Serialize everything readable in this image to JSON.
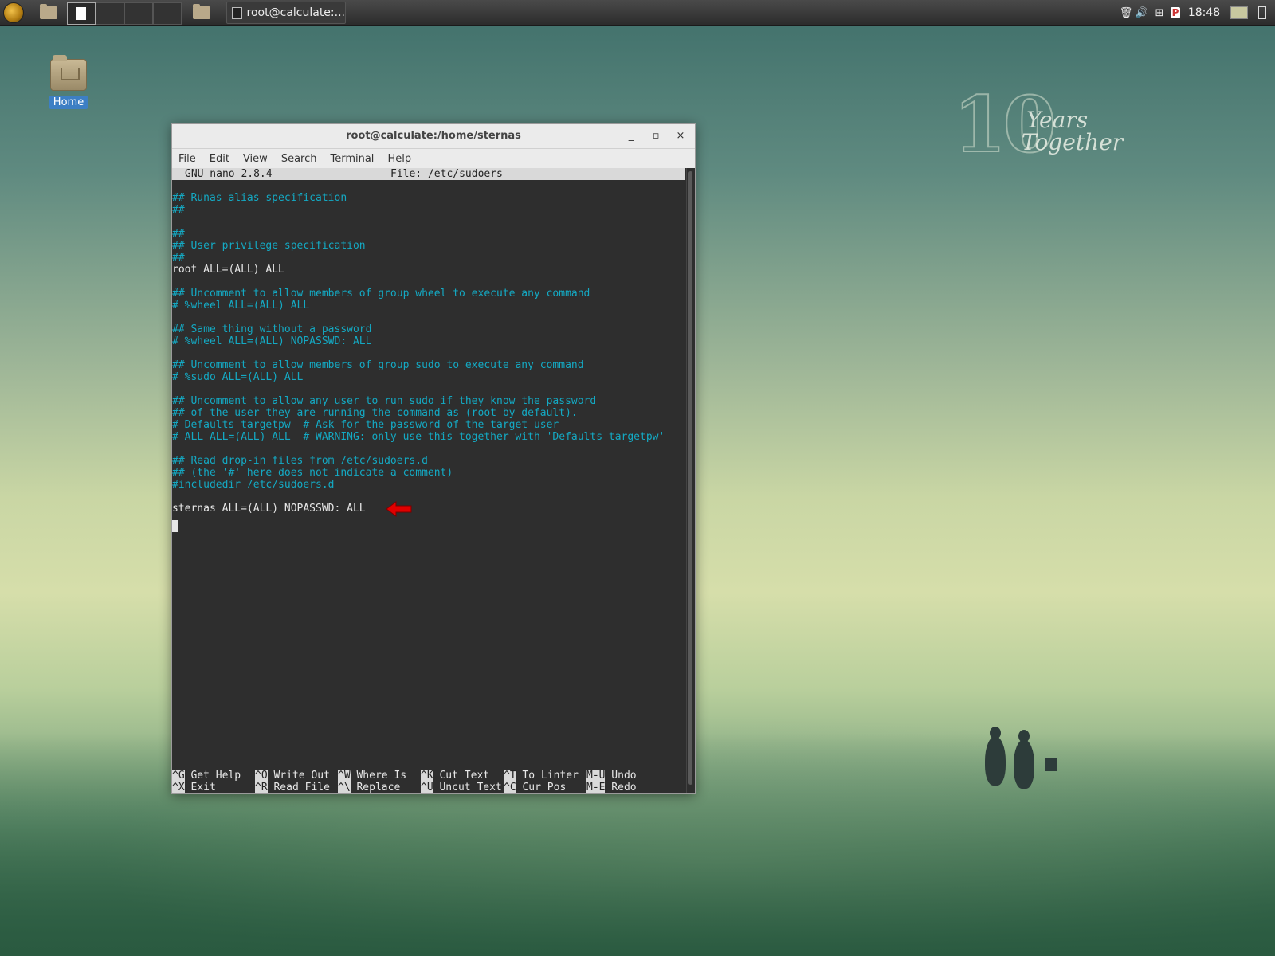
{
  "taskbar": {
    "start_icon": "calculate-logo-icon",
    "workspaces": [
      "1",
      "2",
      "3",
      "4"
    ],
    "task_title": "root@calculate:...",
    "clock": "18:48",
    "tray_icons": [
      "trash-icon",
      "volume-icon",
      "network-icon",
      "p-icon",
      "screen-icon",
      "battery-icon"
    ]
  },
  "desktop": {
    "home_label": "Home",
    "watermark_ten": "10",
    "watermark_years": "Years",
    "watermark_together": "Together"
  },
  "window": {
    "title": "root@calculate:/home/sternas",
    "minimize": "_",
    "maximize": "▫",
    "close": "×",
    "menu": [
      "File",
      "Edit",
      "View",
      "Search",
      "Terminal",
      "Help"
    ]
  },
  "nano": {
    "version": "GNU nano 2.8.4",
    "file": "File: /etc/sudoers",
    "lines": [
      {
        "text": "## Runas alias specification",
        "style": "comment"
      },
      {
        "text": "##",
        "style": "comment"
      },
      {
        "text": "",
        "style": "comment"
      },
      {
        "text": "##",
        "style": "comment"
      },
      {
        "text": "## User privilege specification",
        "style": "comment"
      },
      {
        "text": "##",
        "style": "comment"
      },
      {
        "text": "root ALL=(ALL) ALL",
        "style": "plain"
      },
      {
        "text": "",
        "style": "plain"
      },
      {
        "text": "## Uncomment to allow members of group wheel to execute any command",
        "style": "comment"
      },
      {
        "text": "# %wheel ALL=(ALL) ALL",
        "style": "comment"
      },
      {
        "text": "",
        "style": "plain"
      },
      {
        "text": "## Same thing without a password",
        "style": "comment"
      },
      {
        "text": "# %wheel ALL=(ALL) NOPASSWD: ALL",
        "style": "comment"
      },
      {
        "text": "",
        "style": "plain"
      },
      {
        "text": "## Uncomment to allow members of group sudo to execute any command",
        "style": "comment"
      },
      {
        "text": "# %sudo ALL=(ALL) ALL",
        "style": "comment"
      },
      {
        "text": "",
        "style": "plain"
      },
      {
        "text": "## Uncomment to allow any user to run sudo if they know the password",
        "style": "comment"
      },
      {
        "text": "## of the user they are running the command as (root by default).",
        "style": "comment"
      },
      {
        "text": "# Defaults targetpw  # Ask for the password of the target user",
        "style": "comment"
      },
      {
        "text": "# ALL ALL=(ALL) ALL  # WARNING: only use this together with 'Defaults targetpw'",
        "style": "comment"
      },
      {
        "text": "",
        "style": "plain"
      },
      {
        "text": "## Read drop-in files from /etc/sudoers.d",
        "style": "comment"
      },
      {
        "text": "## (the '#' here does not indicate a comment)",
        "style": "comment"
      },
      {
        "text": "#includedir /etc/sudoers.d",
        "style": "comment"
      },
      {
        "text": "",
        "style": "plain"
      },
      {
        "text": "sternas ALL=(ALL) NOPASSWD: ALL",
        "style": "plain"
      }
    ],
    "shortcuts_row1": [
      {
        "key": "^G",
        "label": "Get Help"
      },
      {
        "key": "^O",
        "label": "Write Out"
      },
      {
        "key": "^W",
        "label": "Where Is"
      },
      {
        "key": "^K",
        "label": "Cut Text"
      },
      {
        "key": "^T",
        "label": "To Linter"
      },
      {
        "key": "M-U",
        "label": "Undo"
      }
    ],
    "shortcuts_row2": [
      {
        "key": "^X",
        "label": "Exit"
      },
      {
        "key": "^R",
        "label": "Read File"
      },
      {
        "key": "^\\",
        "label": "Replace"
      },
      {
        "key": "^U",
        "label": "Uncut Text"
      },
      {
        "key": "^C",
        "label": "Cur Pos"
      },
      {
        "key": "M-E",
        "label": "Redo"
      }
    ]
  },
  "annotation": {
    "arrow_color": "#e00000",
    "icon": "red-arrow-icon"
  },
  "colors": {
    "comment": "#14a9c3",
    "text": "#e6e6e6",
    "terminal_bg": "#2e2e2e"
  }
}
